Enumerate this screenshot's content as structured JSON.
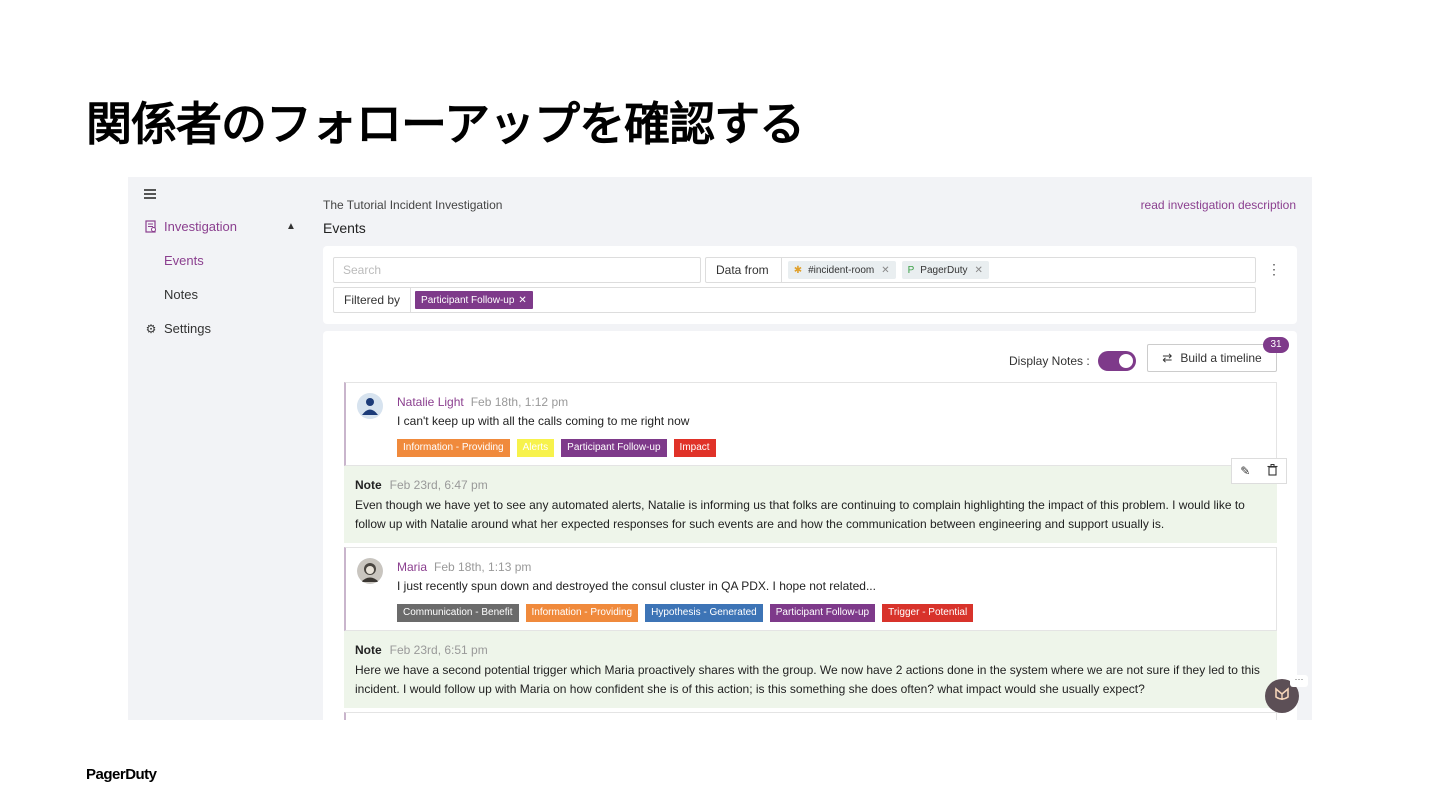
{
  "slide": {
    "title": "関係者のフォローアップを確認する",
    "brand": "PagerDuty"
  },
  "sidebar": {
    "items": [
      {
        "label": "Investigation",
        "icon": "document-icon"
      },
      {
        "label": "Events"
      },
      {
        "label": "Notes"
      },
      {
        "label": "Settings",
        "icon": "gear-icon"
      }
    ]
  },
  "header": {
    "investigation_title": "The Tutorial Incident Investigation",
    "page_heading": "Events",
    "read_description": "read investigation description"
  },
  "filters": {
    "search_placeholder": "Search",
    "data_from_label": "Data from",
    "sources": [
      {
        "label": "#incident-room",
        "icon": "slack-icon",
        "prefix": "✱"
      },
      {
        "label": "PagerDuty",
        "icon": "pagerduty-icon",
        "prefix": "P"
      }
    ],
    "filtered_by_label": "Filtered by",
    "active_filter": "Participant Follow-up"
  },
  "toolbar": {
    "display_notes_label": "Display Notes :",
    "build_timeline_label": "Build a timeline",
    "count": "31"
  },
  "events": [
    {
      "author": "Natalie Light",
      "time": "Feb 18th, 1:12 pm",
      "text": "I can't keep up with all the calls coming to me right now",
      "tags": [
        {
          "label": "Information - Providing",
          "color": "#f08a3c"
        },
        {
          "label": "Alerts",
          "color": "#f7f24c"
        },
        {
          "label": "Participant Follow-up",
          "color": "#7e3a8a"
        },
        {
          "label": "Impact",
          "color": "#e03228"
        }
      ],
      "note": {
        "label": "Note",
        "time": "Feb 23rd, 6:47 pm",
        "body": "Even though we have yet to see any automated alerts, Natalie is informing us that folks are continuing to complain highlighting the impact of this problem. I would like to follow up with Natalie around what her expected responses for such events are and how the communication between engineering and support usually is."
      }
    },
    {
      "author": "Maria",
      "time": "Feb 18th, 1:13 pm",
      "text": "I just recently spun down and destroyed the consul cluster in QA PDX. I hope not related...",
      "tags": [
        {
          "label": "Communication - Benefit",
          "color": "#6b6b6b"
        },
        {
          "label": "Information - Providing",
          "color": "#f08a3c"
        },
        {
          "label": "Hypothesis - Generated",
          "color": "#3d74b6"
        },
        {
          "label": "Participant Follow-up",
          "color": "#7e3a8a"
        },
        {
          "label": "Trigger - Potential",
          "color": "#d8332b"
        }
      ],
      "note": {
        "label": "Note",
        "time": "Feb 23rd, 6:51 pm",
        "body": "Here we have a second potential trigger which Maria proactively shares with the group. We now have 2 actions done in the system where we are not sure if they led to this incident. I would follow up with Maria on how confident she is of this action; is this something she does often? what impact would she usually expect?"
      }
    }
  ],
  "colors": {
    "accent": "#7e3a8a",
    "note_bg": "#eef5ea",
    "app_bg": "#f2f3f6"
  }
}
